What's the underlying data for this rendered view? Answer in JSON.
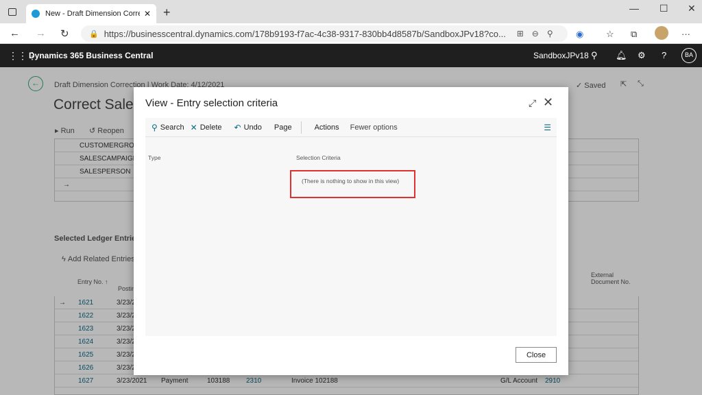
{
  "browser": {
    "tab_title": "New - Draft Dimension Correctio",
    "url": "https://businesscentral.dynamics.com/178b9193-f7ac-4c38-9317-830bb4d8587b/SandboxJPv18?co..."
  },
  "app": {
    "name": "Dynamics 365 Business Central",
    "company": "SandboxJPv18",
    "user_initials": "BA"
  },
  "background": {
    "breadcrumb": "Draft Dimension Correction | Work Date: 4/12/2021",
    "title": "Correct Sales",
    "saved": "Saved",
    "run": "Run",
    "reopen": "Reopen",
    "dimension_rows": [
      "CUSTOMERGROUP",
      "SALESCAMPAIGN",
      "SALESPERSON"
    ],
    "section_title": "Selected Ledger Entries",
    "add_related": "Add Related Entries",
    "col_entry_no": "Entry No. ↑",
    "col_posting": "Posting",
    "col_ext_doc": "External Document No.",
    "entries": [
      "1621",
      "1622",
      "1623",
      "1624",
      "1625",
      "1626",
      "1627"
    ],
    "dates": [
      "3/23/2",
      "3/23/2",
      "3/23/2",
      "3/23/2",
      "3/23/2",
      "3/23/2",
      "3/23/2021"
    ],
    "last_row": {
      "type": "Payment",
      "doc": "103188",
      "code": "2310",
      "desc": "Invoice 102188",
      "acct_type": "G/L Account",
      "acct": "2910"
    }
  },
  "dialog": {
    "title": "View - Entry selection criteria",
    "actions": {
      "search": "Search",
      "delete": "Delete",
      "undo": "Undo",
      "page": "Page",
      "actions": "Actions",
      "fewer": "Fewer options"
    },
    "columns": {
      "type": "Type",
      "criteria": "Selection Criteria"
    },
    "empty_message": "(There is nothing to show in this view)",
    "close_button": "Close"
  }
}
